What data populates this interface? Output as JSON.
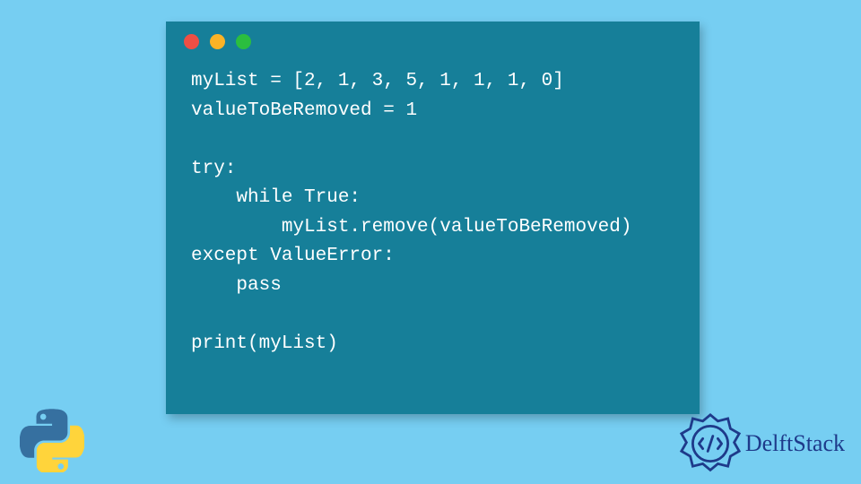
{
  "window": {
    "buttons": {
      "close": "#ee4f44",
      "minimize": "#fbb326",
      "maximize": "#2bbe3f"
    }
  },
  "code": {
    "lines": [
      "myList = [2, 1, 3, 5, 1, 1, 1, 0]",
      "valueToBeRemoved = 1",
      "",
      "try:",
      "    while True:",
      "        myList.remove(valueToBeRemoved)",
      "except ValueError:",
      "    pass",
      "",
      "print(myList)"
    ]
  },
  "branding": {
    "site_name": "DelftStack",
    "python_logo_colors": {
      "top": "#3670a0",
      "bottom": "#ffd43b"
    },
    "delft_color": "#1e3a8a"
  }
}
